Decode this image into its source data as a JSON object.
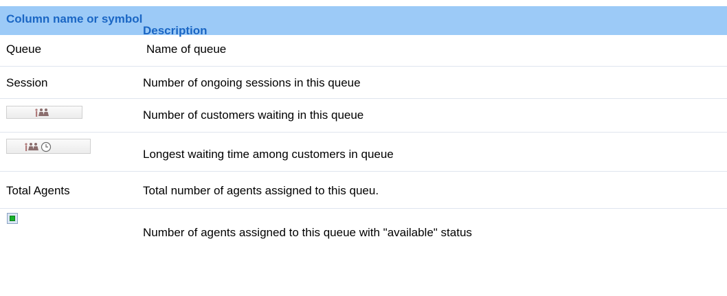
{
  "header": {
    "col1": "Column name or symbol",
    "col2": "Description"
  },
  "rows": [
    {
      "name": "Queue",
      "description": "Name of queue"
    },
    {
      "name": "Session",
      "description": "Number of ongoing sessions in this queue"
    },
    {
      "icon": "waiting-customers-icon",
      "description": "Number of customers waiting in this queue"
    },
    {
      "icon": "longest-wait-time-icon",
      "description": "Longest waiting time among customers in queue"
    },
    {
      "name": "Total Agents",
      "description": "Total number of agents assigned to this queu."
    },
    {
      "icon": "available-status-icon",
      "description": "Number of agents assigned to this queue with \"available\" status"
    }
  ],
  "colors": {
    "header_bg": "#9ccaf7",
    "header_text": "#1a66c4",
    "available_green": "#17b12a"
  }
}
